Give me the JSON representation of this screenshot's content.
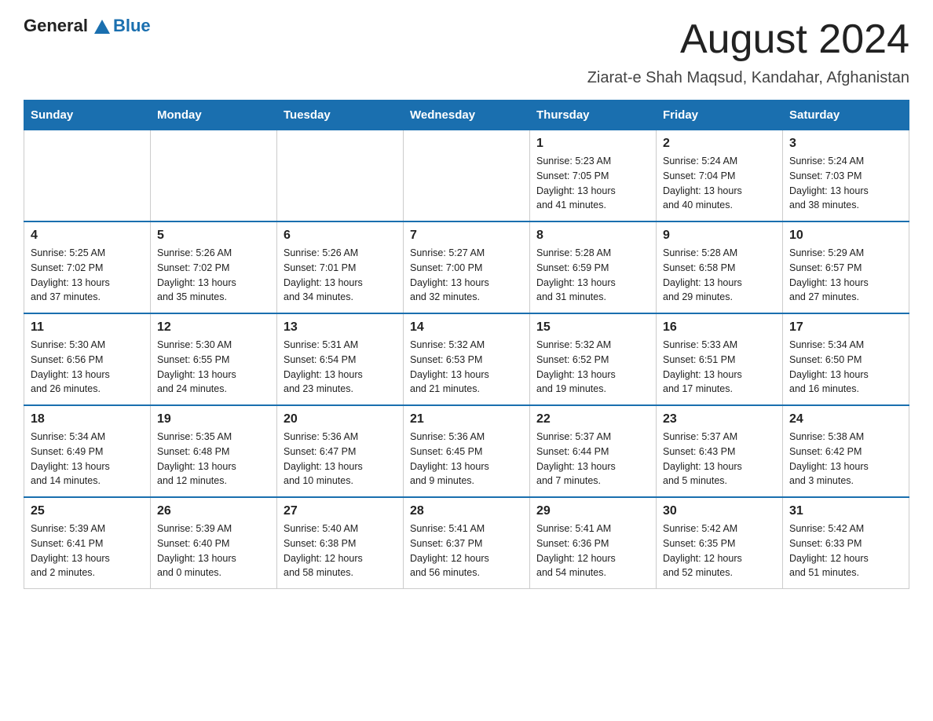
{
  "header": {
    "logo_general": "General",
    "logo_blue": "Blue",
    "month_title": "August 2024",
    "subtitle": "Ziarat-e Shah Maqsud, Kandahar, Afghanistan"
  },
  "weekdays": [
    "Sunday",
    "Monday",
    "Tuesday",
    "Wednesday",
    "Thursday",
    "Friday",
    "Saturday"
  ],
  "weeks": [
    [
      {
        "day": "",
        "detail": ""
      },
      {
        "day": "",
        "detail": ""
      },
      {
        "day": "",
        "detail": ""
      },
      {
        "day": "",
        "detail": ""
      },
      {
        "day": "1",
        "detail": "Sunrise: 5:23 AM\nSunset: 7:05 PM\nDaylight: 13 hours\nand 41 minutes."
      },
      {
        "day": "2",
        "detail": "Sunrise: 5:24 AM\nSunset: 7:04 PM\nDaylight: 13 hours\nand 40 minutes."
      },
      {
        "day": "3",
        "detail": "Sunrise: 5:24 AM\nSunset: 7:03 PM\nDaylight: 13 hours\nand 38 minutes."
      }
    ],
    [
      {
        "day": "4",
        "detail": "Sunrise: 5:25 AM\nSunset: 7:02 PM\nDaylight: 13 hours\nand 37 minutes."
      },
      {
        "day": "5",
        "detail": "Sunrise: 5:26 AM\nSunset: 7:02 PM\nDaylight: 13 hours\nand 35 minutes."
      },
      {
        "day": "6",
        "detail": "Sunrise: 5:26 AM\nSunset: 7:01 PM\nDaylight: 13 hours\nand 34 minutes."
      },
      {
        "day": "7",
        "detail": "Sunrise: 5:27 AM\nSunset: 7:00 PM\nDaylight: 13 hours\nand 32 minutes."
      },
      {
        "day": "8",
        "detail": "Sunrise: 5:28 AM\nSunset: 6:59 PM\nDaylight: 13 hours\nand 31 minutes."
      },
      {
        "day": "9",
        "detail": "Sunrise: 5:28 AM\nSunset: 6:58 PM\nDaylight: 13 hours\nand 29 minutes."
      },
      {
        "day": "10",
        "detail": "Sunrise: 5:29 AM\nSunset: 6:57 PM\nDaylight: 13 hours\nand 27 minutes."
      }
    ],
    [
      {
        "day": "11",
        "detail": "Sunrise: 5:30 AM\nSunset: 6:56 PM\nDaylight: 13 hours\nand 26 minutes."
      },
      {
        "day": "12",
        "detail": "Sunrise: 5:30 AM\nSunset: 6:55 PM\nDaylight: 13 hours\nand 24 minutes."
      },
      {
        "day": "13",
        "detail": "Sunrise: 5:31 AM\nSunset: 6:54 PM\nDaylight: 13 hours\nand 23 minutes."
      },
      {
        "day": "14",
        "detail": "Sunrise: 5:32 AM\nSunset: 6:53 PM\nDaylight: 13 hours\nand 21 minutes."
      },
      {
        "day": "15",
        "detail": "Sunrise: 5:32 AM\nSunset: 6:52 PM\nDaylight: 13 hours\nand 19 minutes."
      },
      {
        "day": "16",
        "detail": "Sunrise: 5:33 AM\nSunset: 6:51 PM\nDaylight: 13 hours\nand 17 minutes."
      },
      {
        "day": "17",
        "detail": "Sunrise: 5:34 AM\nSunset: 6:50 PM\nDaylight: 13 hours\nand 16 minutes."
      }
    ],
    [
      {
        "day": "18",
        "detail": "Sunrise: 5:34 AM\nSunset: 6:49 PM\nDaylight: 13 hours\nand 14 minutes."
      },
      {
        "day": "19",
        "detail": "Sunrise: 5:35 AM\nSunset: 6:48 PM\nDaylight: 13 hours\nand 12 minutes."
      },
      {
        "day": "20",
        "detail": "Sunrise: 5:36 AM\nSunset: 6:47 PM\nDaylight: 13 hours\nand 10 minutes."
      },
      {
        "day": "21",
        "detail": "Sunrise: 5:36 AM\nSunset: 6:45 PM\nDaylight: 13 hours\nand 9 minutes."
      },
      {
        "day": "22",
        "detail": "Sunrise: 5:37 AM\nSunset: 6:44 PM\nDaylight: 13 hours\nand 7 minutes."
      },
      {
        "day": "23",
        "detail": "Sunrise: 5:37 AM\nSunset: 6:43 PM\nDaylight: 13 hours\nand 5 minutes."
      },
      {
        "day": "24",
        "detail": "Sunrise: 5:38 AM\nSunset: 6:42 PM\nDaylight: 13 hours\nand 3 minutes."
      }
    ],
    [
      {
        "day": "25",
        "detail": "Sunrise: 5:39 AM\nSunset: 6:41 PM\nDaylight: 13 hours\nand 2 minutes."
      },
      {
        "day": "26",
        "detail": "Sunrise: 5:39 AM\nSunset: 6:40 PM\nDaylight: 13 hours\nand 0 minutes."
      },
      {
        "day": "27",
        "detail": "Sunrise: 5:40 AM\nSunset: 6:38 PM\nDaylight: 12 hours\nand 58 minutes."
      },
      {
        "day": "28",
        "detail": "Sunrise: 5:41 AM\nSunset: 6:37 PM\nDaylight: 12 hours\nand 56 minutes."
      },
      {
        "day": "29",
        "detail": "Sunrise: 5:41 AM\nSunset: 6:36 PM\nDaylight: 12 hours\nand 54 minutes."
      },
      {
        "day": "30",
        "detail": "Sunrise: 5:42 AM\nSunset: 6:35 PM\nDaylight: 12 hours\nand 52 minutes."
      },
      {
        "day": "31",
        "detail": "Sunrise: 5:42 AM\nSunset: 6:33 PM\nDaylight: 12 hours\nand 51 minutes."
      }
    ]
  ]
}
